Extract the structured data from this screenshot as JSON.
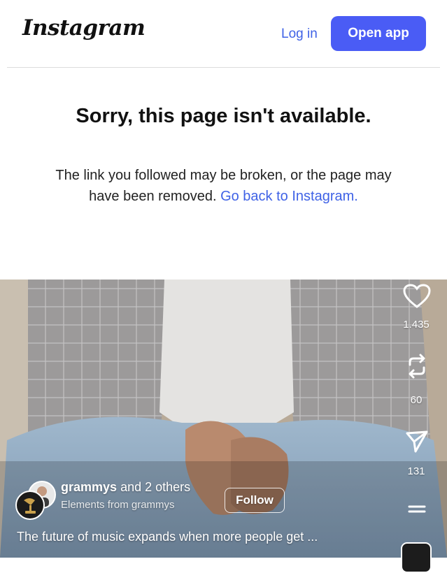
{
  "header": {
    "logo": "Instagram",
    "login_label": "Log in",
    "open_app_label": "Open app"
  },
  "error": {
    "title": "Sorry, this page isn't available.",
    "body": "The link you followed may be broken, or the page may have been removed.",
    "link_label": "Go back to Instagram."
  },
  "reel": {
    "author_name": "grammys",
    "author_others": "and 2 others",
    "author_sub": "Elements from grammys",
    "follow_label": "Follow",
    "caption": "The future of music expands when more people get ...",
    "likes": "1.435",
    "reposts": "60",
    "shares": "131",
    "icons": [
      "heart-icon",
      "repost-icon",
      "send-icon",
      "more-icon"
    ]
  },
  "colors": {
    "accent": "#4a5cf5",
    "link": "#3f62e6"
  }
}
